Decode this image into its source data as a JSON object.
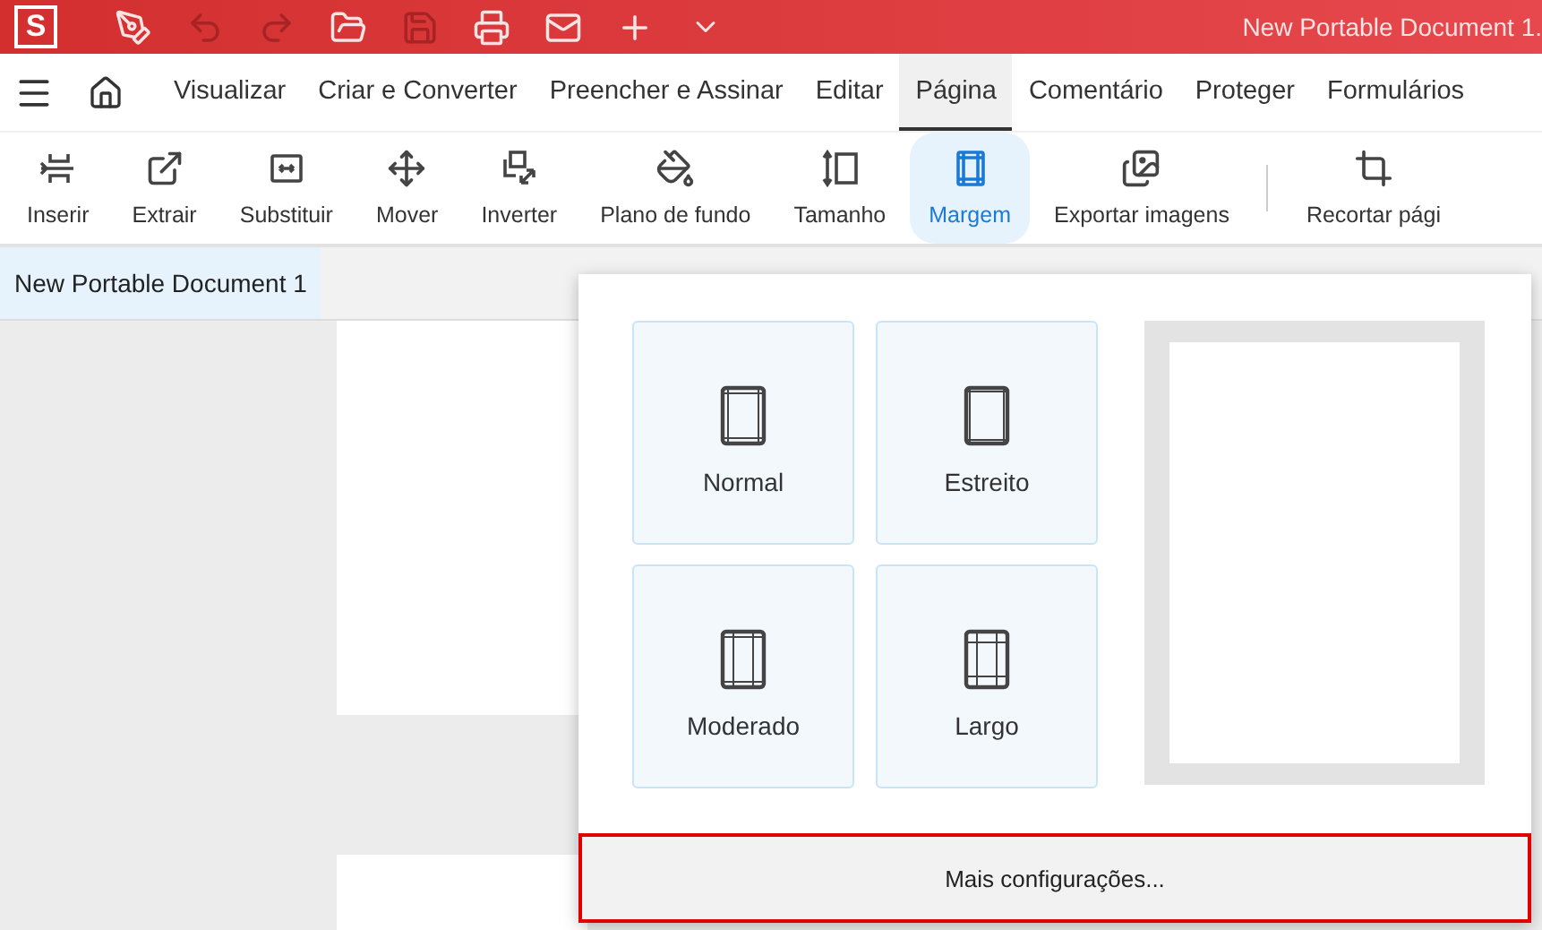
{
  "app": {
    "logo": "S",
    "document_title": "New Portable Document 1."
  },
  "quick_actions": [
    {
      "kind": "pen",
      "disabled": false
    },
    {
      "kind": "undo",
      "disabled": true
    },
    {
      "kind": "redo",
      "disabled": true
    },
    {
      "kind": "open",
      "disabled": false
    },
    {
      "kind": "save",
      "disabled": true
    },
    {
      "kind": "print",
      "disabled": false
    },
    {
      "kind": "mail",
      "disabled": false
    },
    {
      "kind": "new",
      "disabled": false
    },
    {
      "kind": "more",
      "disabled": false
    }
  ],
  "menu_tabs": [
    {
      "label": "Visualizar",
      "selected": false
    },
    {
      "label": "Criar e Converter",
      "selected": false
    },
    {
      "label": "Preencher e Assinar",
      "selected": false
    },
    {
      "label": "Editar",
      "selected": false
    },
    {
      "label": "Página",
      "selected": true
    },
    {
      "label": "Comentário",
      "selected": false
    },
    {
      "label": "Proteger",
      "selected": false
    },
    {
      "label": "Formulários",
      "selected": false
    }
  ],
  "tools": [
    {
      "label": "Inserir",
      "kind": "insert",
      "selected": false
    },
    {
      "label": "Extrair",
      "kind": "extract",
      "selected": false
    },
    {
      "label": "Substituir",
      "kind": "replace",
      "selected": false
    },
    {
      "label": "Mover",
      "kind": "move",
      "selected": false
    },
    {
      "label": "Inverter",
      "kind": "rotate",
      "selected": false
    },
    {
      "label": "Plano de fundo",
      "kind": "background",
      "selected": false
    },
    {
      "label": "Tamanho",
      "kind": "size",
      "selected": false
    },
    {
      "label": "Margem",
      "kind": "margin",
      "selected": true
    },
    {
      "label": "Exportar imagens",
      "kind": "export",
      "selected": false
    },
    {
      "label": "Recortar pági",
      "kind": "crop",
      "selected": false
    }
  ],
  "document_tabs": [
    {
      "label": "New Portable Document 1",
      "selected": true
    }
  ],
  "margin_menu": {
    "options": [
      {
        "label": "Normal",
        "kind": "normal"
      },
      {
        "label": "Estreito",
        "kind": "narrow"
      },
      {
        "label": "Moderado",
        "kind": "moderate"
      },
      {
        "label": "Largo",
        "kind": "wide"
      }
    ],
    "more_settings": "Mais configurações..."
  }
}
